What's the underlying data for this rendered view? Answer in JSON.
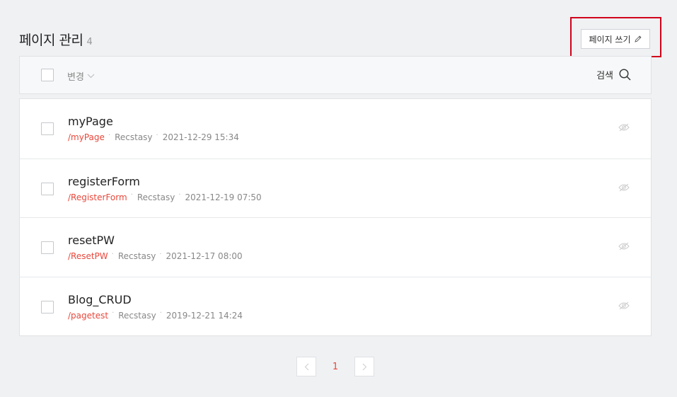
{
  "header": {
    "title": "페이지 관리",
    "count": "4"
  },
  "toolbar": {
    "write_label": "페이지 쓰기",
    "change_label": "변경",
    "search_label": "검색"
  },
  "pages": [
    {
      "title": "myPage",
      "path": "/myPage",
      "author": "Recstasy",
      "date": "2021-12-29 15:34"
    },
    {
      "title": "registerForm",
      "path": "/RegisterForm",
      "author": "Recstasy",
      "date": "2021-12-19 07:50"
    },
    {
      "title": "resetPW",
      "path": "/ResetPW",
      "author": "Recstasy",
      "date": "2021-12-17 08:00"
    },
    {
      "title": "Blog_CRUD",
      "path": "/pagetest",
      "author": "Recstasy",
      "date": "2019-12-21 14:24"
    }
  ],
  "pagination": {
    "current": "1"
  },
  "icons": {
    "write": "pencil-icon",
    "change": "chevron-down-icon",
    "search": "search-icon",
    "visibility": "eye-icon",
    "prev": "chevron-left-icon",
    "next": "chevron-right-icon"
  },
  "colors": {
    "accent": "#e8483c",
    "highlight": "#d0021b",
    "background": "#f0f1f3"
  }
}
